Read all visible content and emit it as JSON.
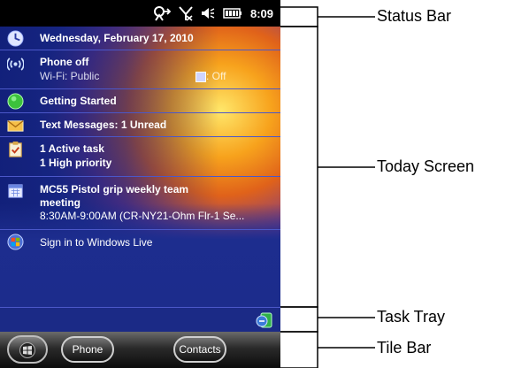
{
  "status_bar": {
    "time": "8:09"
  },
  "today": {
    "date": "Wednesday, February 17, 2010",
    "phone_title": "Phone off",
    "wifi": "Wi-Fi: Public",
    "bt_status": ": Off",
    "getting_started": "Getting Started",
    "messages": "Text Messages: 1 Unread",
    "tasks_line1": "1 Active task",
    "tasks_line2": "1 High priority",
    "meeting_line1": "MC55 Pistol grip weekly team",
    "meeting_line2": "meeting",
    "meeting_line3": "8:30AM-9:00AM (CR-NY21-Ohm Flr-1 Se...",
    "windows_live": "Sign in to Windows Live"
  },
  "tile_bar": {
    "phone_label": "Phone",
    "contacts_label": "Contacts"
  },
  "callouts": {
    "status_bar": "Status Bar",
    "today_screen": "Today Screen",
    "task_tray": "Task Tray",
    "tile_bar": "Tile Bar"
  }
}
